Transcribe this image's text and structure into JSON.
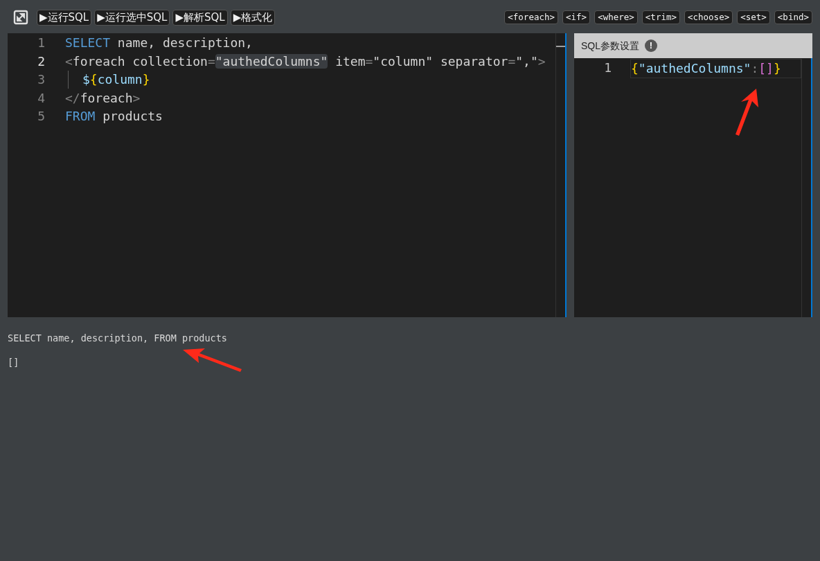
{
  "toolbar": {
    "run_buttons": [
      "▶运行SQL",
      "▶运行选中SQL",
      "▶解析SQL",
      "▶格式化"
    ],
    "tag_buttons": [
      "<foreach>",
      "<if>",
      "<where>",
      "<trim>",
      "<choose>",
      "<set>",
      "<bind>"
    ]
  },
  "editor": {
    "lines": [
      {
        "number": "1",
        "current": false,
        "tokens": [
          {
            "kind": "keyword",
            "text": "SELECT"
          },
          {
            "kind": "plain",
            "text": " name, description,"
          }
        ]
      },
      {
        "number": "2",
        "current": true,
        "tokens": [
          {
            "kind": "punct",
            "text": "<"
          },
          {
            "kind": "plain",
            "text": "foreach collection"
          },
          {
            "kind": "punct",
            "text": "="
          },
          {
            "kind": "highlight",
            "text": "\"authedColumns\""
          },
          {
            "kind": "plain",
            "text": " item"
          },
          {
            "kind": "punct",
            "text": "="
          },
          {
            "kind": "plain",
            "text": "\"column\" separator"
          },
          {
            "kind": "punct",
            "text": "="
          },
          {
            "kind": "plain",
            "text": "\",\""
          },
          {
            "kind": "punct",
            "text": ">"
          }
        ]
      },
      {
        "number": "3",
        "current": false,
        "tokens": [
          {
            "kind": "indent"
          },
          {
            "kind": "dollar",
            "text": "$"
          },
          {
            "kind": "brace",
            "text": "{"
          },
          {
            "kind": "var",
            "text": "column"
          },
          {
            "kind": "brace",
            "text": "}"
          }
        ]
      },
      {
        "number": "4",
        "current": false,
        "tokens": [
          {
            "kind": "punct",
            "text": "</"
          },
          {
            "kind": "plain",
            "text": "foreach"
          },
          {
            "kind": "punct",
            "text": ">"
          }
        ]
      },
      {
        "number": "5",
        "current": false,
        "tokens": [
          {
            "kind": "keyword",
            "text": "FROM"
          },
          {
            "kind": "plain",
            "text": " products"
          }
        ]
      }
    ]
  },
  "params_panel": {
    "title": "SQL参数设置",
    "info_icon": "!",
    "lines": [
      {
        "number": "1",
        "tokens": [
          {
            "kind": "brace",
            "text": "{"
          },
          {
            "kind": "var",
            "text": "\"authedColumns\""
          },
          {
            "kind": "punct",
            "text": ":"
          },
          {
            "kind": "bracket",
            "text": "[]"
          },
          {
            "kind": "brace",
            "text": "}"
          }
        ]
      }
    ]
  },
  "output": {
    "sql": "SELECT name, description, FROM products",
    "result": "[]"
  }
}
